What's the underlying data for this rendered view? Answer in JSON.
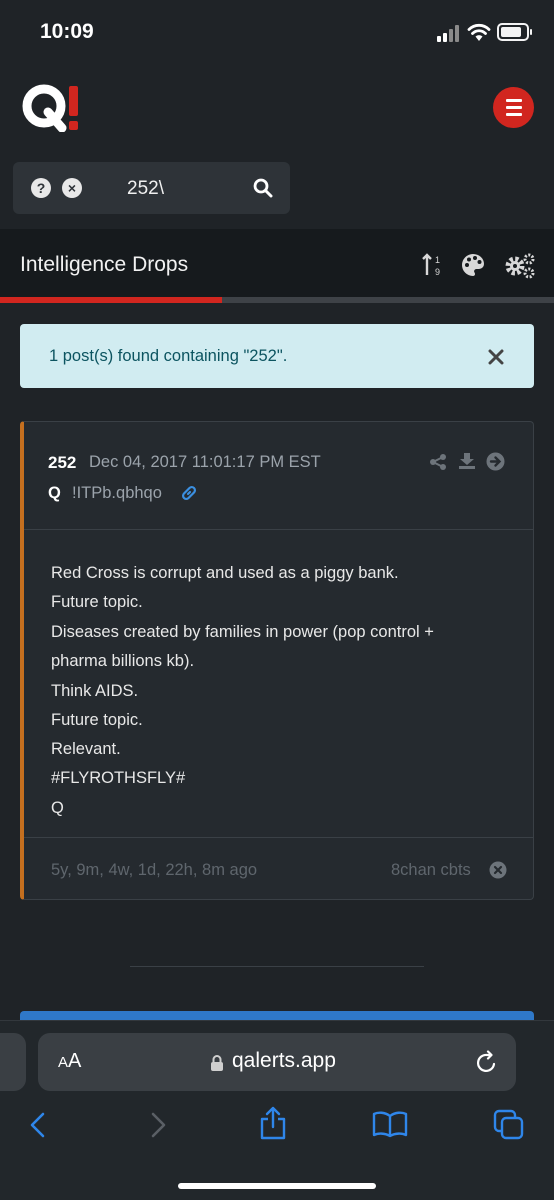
{
  "status_bar": {
    "time": "10:09"
  },
  "header": {
    "logo_text": "Q!"
  },
  "search": {
    "value": "252\\"
  },
  "page": {
    "title": "Intelligence Drops",
    "progress_fraction": 0.4
  },
  "alert": {
    "message": "1 post(s) found containing \"252\"."
  },
  "post": {
    "number": "252",
    "date": "Dec 04, 2017 11:01:17 PM EST",
    "author": "Q",
    "tripcode": "!ITPb.qbhqo",
    "body_lines": [
      "Red Cross is corrupt and used as a piggy bank.",
      "Future topic.",
      "Diseases created by families in power (pop control +",
      "pharma billions kb).",
      "Think AIDS.",
      "Future topic.",
      "Relevant.",
      "#FLYROTHSFLY#",
      "Q"
    ],
    "age": "5y, 9m, 4w, 1d, 22h, 8m ago",
    "source": "8chan cbts"
  },
  "browser": {
    "text_size_label_small": "A",
    "text_size_label_big": "A",
    "url": "qalerts.app"
  },
  "colors": {
    "accent_red": "#d1261f",
    "post_border": "#c46f1f",
    "alert_bg": "#d1ecf1",
    "link_blue": "#2f78c8"
  }
}
